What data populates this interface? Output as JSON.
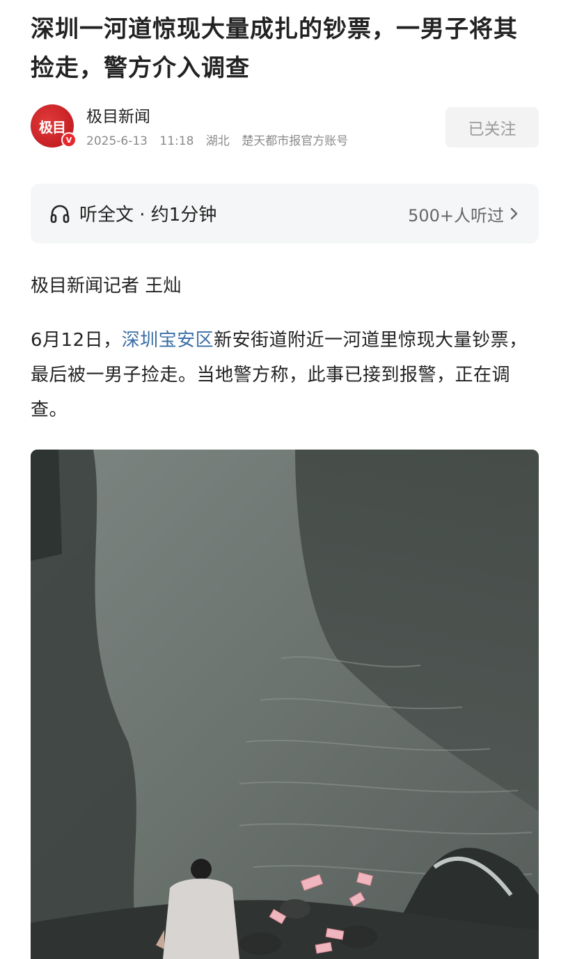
{
  "article": {
    "title": "深圳一河道惊现大量成扎的钞票，一男子将其捡走，警方介入调查"
  },
  "author": {
    "avatar_text": "极目",
    "verified_mark": "V",
    "name": "极目新闻",
    "date": "2025-6-13",
    "time": "11:18",
    "region": "湖北",
    "account": "楚天都市报官方账号",
    "follow_label": "已关注"
  },
  "listen": {
    "icon": "headphone-icon",
    "label": "听全文 · 约1分钟",
    "count": "500+人听过",
    "chevron_icon": "chevron-right-icon"
  },
  "body": {
    "reporter": "极目新闻记者 王灿",
    "para_prefix": "6月12日，",
    "para_link": "深圳宝安区",
    "para_rest": "新安街道附近一河道里惊现大量钞票，最后被一男子捡走。当地警方称，此事已接到报警，正在调查。"
  },
  "colors": {
    "link": "#3a6ea5",
    "brand_red": "#e8272d",
    "muted": "#8a8a8a"
  }
}
